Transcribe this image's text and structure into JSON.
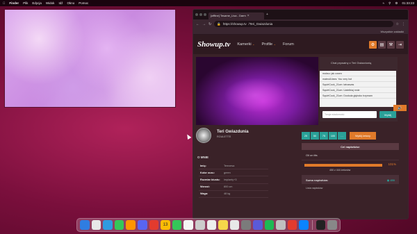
{
  "menubar": {
    "app": "Finder",
    "items": [
      "Plik",
      "Edycja",
      "Widok",
      "Idź",
      "Okno",
      "Pomoc"
    ],
    "clock": "01:33:23"
  },
  "browser": {
    "tab_title": "[offline] Tesame_Lisa - Darm",
    "url_host": "https://showup.tv",
    "url_path": "/Teri_Gwiazdunia",
    "bookmarks_label": "Wszystkie zakładki"
  },
  "site": {
    "logo": "Showup.tv",
    "nav": [
      {
        "label": "Kamerki"
      },
      {
        "label": "Profile"
      },
      {
        "label": "Forum"
      }
    ],
    "header_icon_colors": [
      "#e07a2a",
      "#5a3a42",
      "#5a3a42",
      "#5a3a42"
    ]
  },
  "chat": {
    "title": "Chat prywatny z Teri Gwiazdunią",
    "messages": [
      "moksu: jak cosen",
      "mateo&Vaes: You very hot",
      "SquirtCock_21cm: latvasvas",
      "SquirtCock_21cm: Uwielbiaj mnie",
      "SquirtCock_21cm: Dookola głęboko trzymam"
    ],
    "input_placeholder": "Twoja wiadomość",
    "send_label": "Wyślij"
  },
  "profile": {
    "name": "Teri Gwiazdunia",
    "room": "ROULETTE",
    "about_title": "O MNIE",
    "about": [
      {
        "k": "Imię:",
        "v": "Terezesa"
      },
      {
        "k": "Kolor oczu:",
        "v": "green"
      },
      {
        "k": "Rozmiar biustu:",
        "v": "implanty+3"
      },
      {
        "k": "Wzrost:",
        "v": "800 cm"
      },
      {
        "k": "Waga:",
        "v": "48 kg"
      }
    ]
  },
  "tips": {
    "amounts": [
      "25",
      "50",
      "75",
      "100",
      "…"
    ],
    "send_label": "Wyślij żetony"
  },
  "goal": {
    "header": "Cel napiwków:",
    "text": "Oil on tits",
    "percent": "101%",
    "progress": 1.0,
    "tokens": "450 z 444 żetonów",
    "sum_label": "Suma napiwków:",
    "sum_value": "450",
    "list_label": "Lista napiwków"
  },
  "dock": {
    "icon_colors": [
      "#2f7de1",
      "#e8e8e8",
      "#2f9be0",
      "#35c759",
      "#ff9500",
      "#5865f2",
      "#e33b2e",
      "#fbbc05",
      "#34c759",
      "#f5f5f5",
      "#cccccc",
      "#eeeeee",
      "#f7d74a",
      "#e8e8e8",
      "#7b7b7b",
      "#5a5ad8",
      "#1db954",
      "#c0c0c0",
      "#e33b2e",
      "#0a84ff",
      "#222222",
      "#888888"
    ],
    "calendar_day": "13"
  }
}
